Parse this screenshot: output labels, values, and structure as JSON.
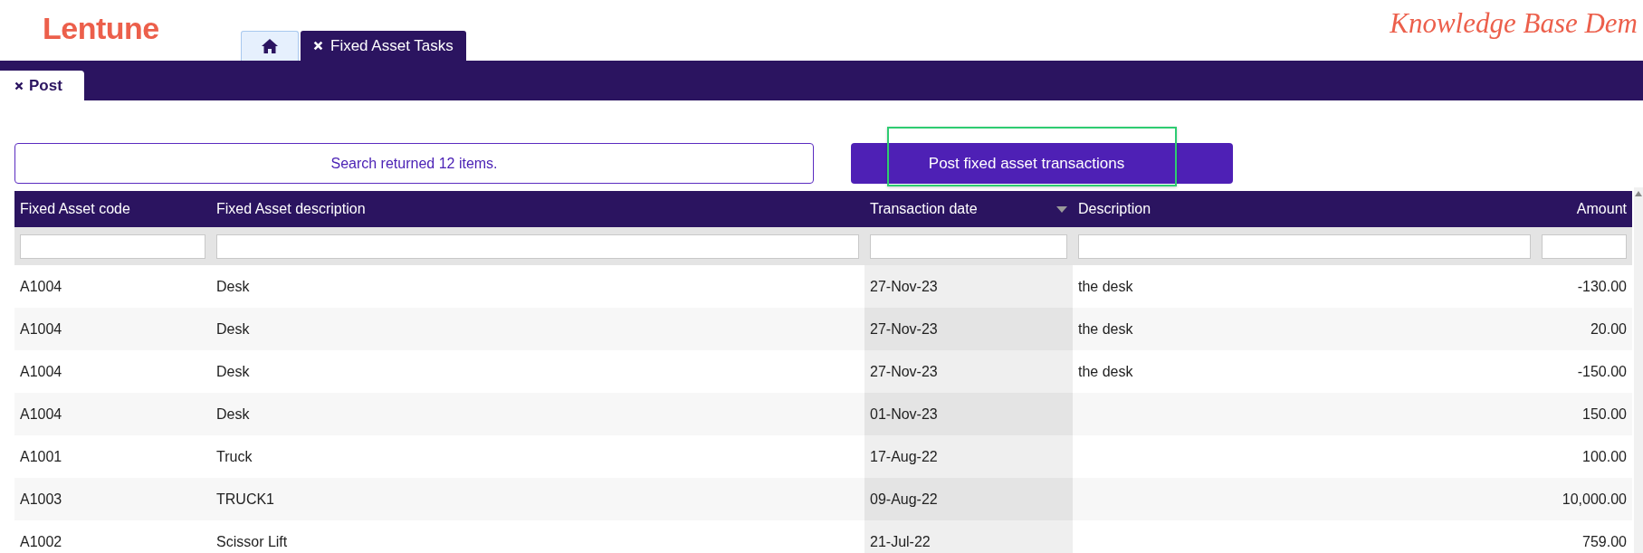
{
  "header": {
    "logo": "Lentune",
    "tagline": "Knowledge Base Dem"
  },
  "app_tabs": [
    {
      "kind": "home",
      "selected": false
    },
    {
      "kind": "text",
      "label": "Fixed Asset Tasks",
      "selected": true
    }
  ],
  "sub_tabs": [
    {
      "label": "Post",
      "selected": true
    }
  ],
  "search_status": "Search returned 12 items.",
  "post_button": {
    "label": "Post fixed asset transactions",
    "highlighted": true
  },
  "table": {
    "columns": [
      {
        "label": "Fixed Asset code",
        "sorted": false
      },
      {
        "label": "Fixed Asset description",
        "sorted": false
      },
      {
        "label": "Transaction date",
        "sorted": true
      },
      {
        "label": "Description",
        "sorted": false
      },
      {
        "label": "Amount",
        "sorted": false
      }
    ],
    "rows": [
      [
        "A1004",
        "Desk",
        "27-Nov-23",
        "the desk",
        "-130.00"
      ],
      [
        "A1004",
        "Desk",
        "27-Nov-23",
        "the desk",
        "20.00"
      ],
      [
        "A1004",
        "Desk",
        "27-Nov-23",
        "the desk",
        "-150.00"
      ],
      [
        "A1004",
        "Desk",
        "01-Nov-23",
        "",
        "150.00"
      ],
      [
        "A1001",
        "Truck",
        "17-Aug-22",
        "",
        "100.00"
      ],
      [
        "A1003",
        "TRUCK1",
        "09-Aug-22",
        "",
        "10,000.00"
      ],
      [
        "A1002",
        "Scissor Lift",
        "21-Jul-22",
        "",
        "759.00"
      ]
    ]
  }
}
